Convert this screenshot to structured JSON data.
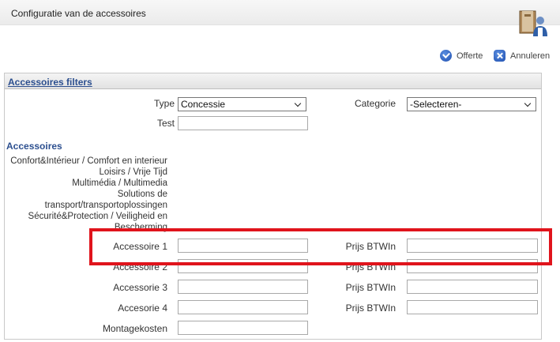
{
  "window": {
    "title": "Configuratie van de accessoires"
  },
  "actions": {
    "offerte": "Offerte",
    "annuleren": "Annuleren"
  },
  "panel": {
    "title": "Accessoires filters"
  },
  "filters": {
    "type_label": "Type",
    "type_value": "Concessie",
    "categorie_label": "Categorie",
    "categorie_value": "-Selecteren-",
    "test_label": "Test",
    "test_value": ""
  },
  "accessoires": {
    "heading": "Accessoires",
    "categories": [
      "Confort&Intérieur / Comfort en interieur",
      "Loisirs / Vrije Tijd",
      "Multimédia / Multimedia",
      "Solutions de",
      "transport/transportoplossingen",
      "Sécurité&Protection / Veiligheid en",
      "Bescherming"
    ]
  },
  "rows": [
    {
      "label": "Accessoire 1",
      "price_label": "Prijs BTWIn",
      "value": "",
      "price": ""
    },
    {
      "label": "Accessoire 2",
      "price_label": "Prijs BTWIn",
      "value": "",
      "price": ""
    },
    {
      "label": "Accessorie 3",
      "price_label": "Prijs BTWIn",
      "value": "",
      "price": ""
    },
    {
      "label": "Accesorie 4",
      "price_label": "Prijs BTWIn",
      "value": "",
      "price": ""
    }
  ],
  "montage": {
    "label": "Montagekosten",
    "value": ""
  },
  "colors": {
    "highlight": "#e0141c",
    "section_blue": "#2c4f8f"
  }
}
